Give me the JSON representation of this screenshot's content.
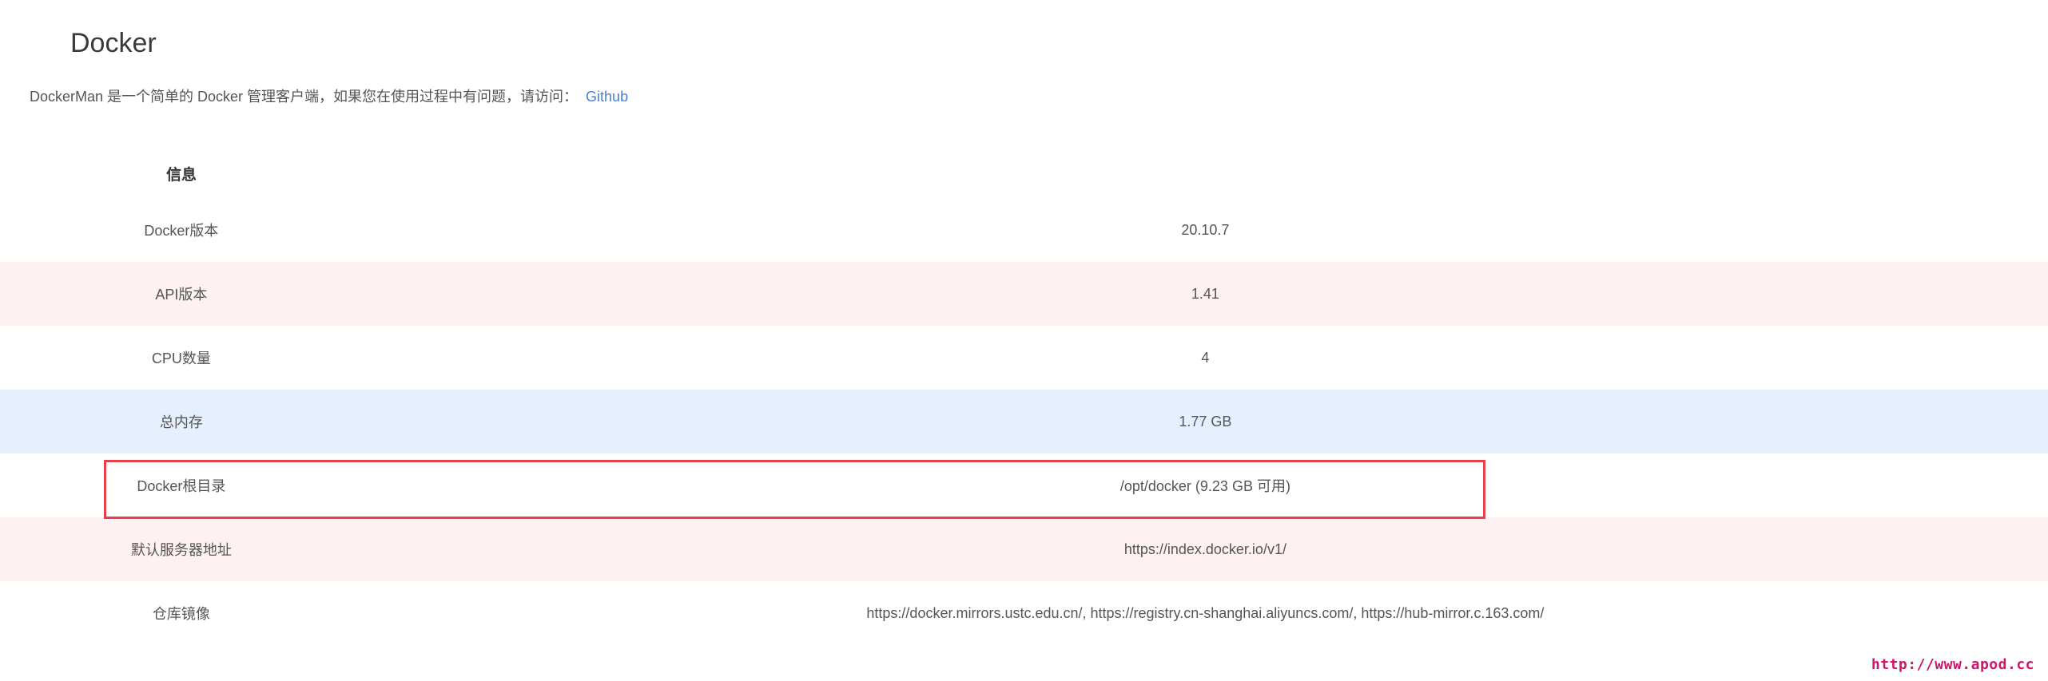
{
  "page": {
    "title": "Docker",
    "description": "DockerMan 是一个简单的 Docker 管理客户端，如果您在使用过程中有问题，请访问：",
    "link_text": "Github"
  },
  "info": {
    "header": "信息",
    "rows": [
      {
        "key": "Docker版本",
        "value": "20.10.7"
      },
      {
        "key": "API版本",
        "value": "1.41"
      },
      {
        "key": "CPU数量",
        "value": "4"
      },
      {
        "key": "总内存",
        "value": "1.77 GB"
      },
      {
        "key": "Docker根目录",
        "value": "/opt/docker (9.23 GB 可用)"
      },
      {
        "key": "默认服务器地址",
        "value": "https://index.docker.io/v1/"
      },
      {
        "key": "仓库镜像",
        "value": "https://docker.mirrors.ustc.edu.cn/, https://registry.cn-shanghai.aliyuncs.com/, https://hub-mirror.c.163.com/"
      }
    ]
  },
  "watermark": "http://www.apod.cc",
  "colors": {
    "link": "#4a7fd4",
    "row_pink": "#fdf2f1",
    "row_blue": "#e6effd",
    "highlight": "#e6414a",
    "watermark": "#d0146c"
  }
}
